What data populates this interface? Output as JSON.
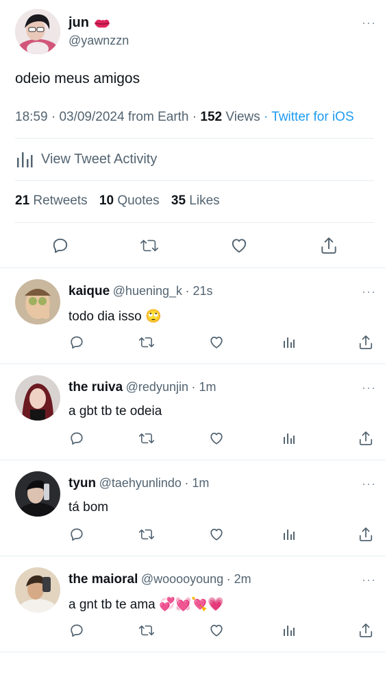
{
  "tweet": {
    "author_name": "jun",
    "author_emoji": "💋",
    "author_handle": "@yawnzzn",
    "text": "odeio meus amigos",
    "time": "18:59",
    "date": "03/09/2024",
    "location": "from Earth",
    "views_count": "152",
    "views_label": "Views",
    "client": "Twitter for iOS",
    "activity_label": "View Tweet Activity",
    "retweets_count": "21",
    "retweets_label": "Retweets",
    "quotes_count": "10",
    "quotes_label": "Quotes",
    "likes_count": "35",
    "likes_label": "Likes"
  },
  "replies": [
    {
      "name": "kaique",
      "handle": "@huening_k",
      "time": "21s",
      "text": "todo dia isso",
      "emoji": "🙄"
    },
    {
      "name": "the ruiva",
      "handle": "@redyunjin",
      "time": "1m",
      "text": "a gbt tb te odeia",
      "emoji": ""
    },
    {
      "name": "tyun",
      "handle": "@taehyunlindo",
      "time": "1m",
      "text": "tá bom",
      "emoji": ""
    },
    {
      "name": "the maioral",
      "handle": "@wooooyoung",
      "time": "2m",
      "text": "a gnt tb te ama",
      "emoji": "💞💓💘💗"
    }
  ],
  "colors": {
    "accent": "#1d9bf0",
    "text": "#0f1419",
    "muted": "#536471",
    "divider": "#e6ecf0",
    "lipstick": "#e0245e"
  },
  "icons": {
    "reply": "reply-icon",
    "retweet": "retweet-icon",
    "like": "heart-icon",
    "share": "share-icon",
    "views": "bar-chart-icon",
    "more": "more-icon"
  }
}
